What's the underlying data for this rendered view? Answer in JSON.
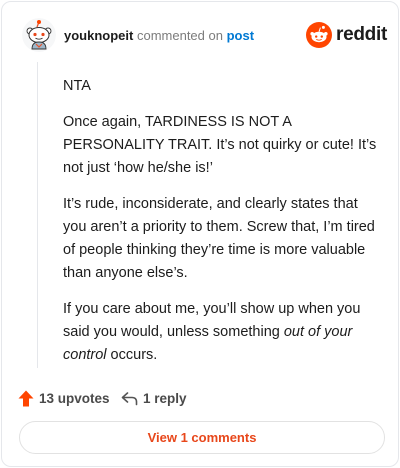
{
  "header": {
    "username": "youknopeit",
    "commented_on": "commented on",
    "post_link": "post",
    "brand": "reddit"
  },
  "comment": {
    "paragraphs": {
      "p1": "NTA",
      "p2": "Once again, TARDINESS IS NOT A PERSONALITY TRAIT. It’s not quirky or cute! It’s not just ‘how he/she is!’",
      "p3": "It’s rude, inconsiderate, and clearly states that you aren’t a priority to them. Screw that, I’m tired of people thinking they’re time is more valuable than anyone else’s.",
      "p4_before": "If you care about me, you’ll show up when you said you would, unless something ",
      "p4_italic": "out of your control",
      "p4_after": " occurs."
    }
  },
  "actions": {
    "upvotes": "13 upvotes",
    "replies": "1 reply"
  },
  "footer": {
    "view_comments": "View 1 comments"
  },
  "colors": {
    "upvote": "#ff4500",
    "reddit_orange": "#ff4500",
    "link_blue": "#0079d3",
    "view_button_text": "#e8471b"
  },
  "icons": {
    "avatar": "snoo-avatar",
    "brand": "reddit-logo-icon",
    "upvote": "upvote-arrow-icon",
    "reply": "reply-arrow-icon"
  }
}
